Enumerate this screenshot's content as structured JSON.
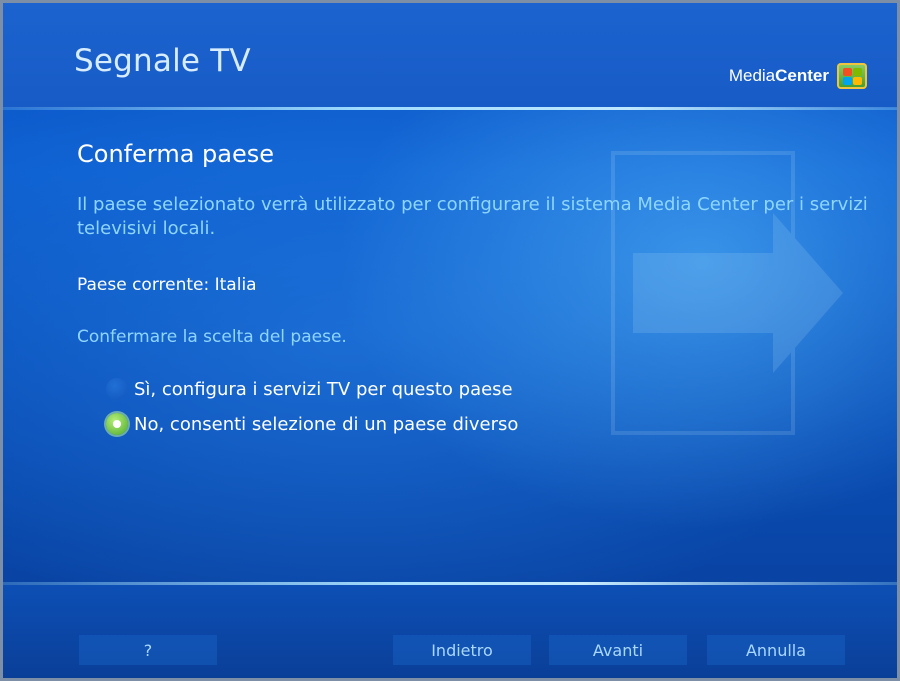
{
  "header": {
    "title": "Segnale TV",
    "brand_prefix": "Media",
    "brand_suffix": "Center",
    "logo_icon": "windows-flag-icon"
  },
  "main": {
    "section_title": "Conferma paese",
    "description": "Il paese selezionato verrà utilizzato per configurare il sistema Media Center per i servizi televisivi locali.",
    "current_country": "Paese corrente: Italia",
    "prompt": "Confermare la scelta del paese.",
    "options": [
      {
        "label": "Sì, configura i servizi TV per questo paese",
        "selected": false
      },
      {
        "label": "No, consenti selezione di un paese diverso",
        "selected": true
      }
    ]
  },
  "footer": {
    "help_label": "?",
    "back_label": "Indietro",
    "next_label": "Avanti",
    "cancel_label": "Annulla"
  },
  "colors": {
    "background": "#0d5fd0",
    "accent_text": "#8fd6ff",
    "selected_radio": "#4ca82a"
  }
}
